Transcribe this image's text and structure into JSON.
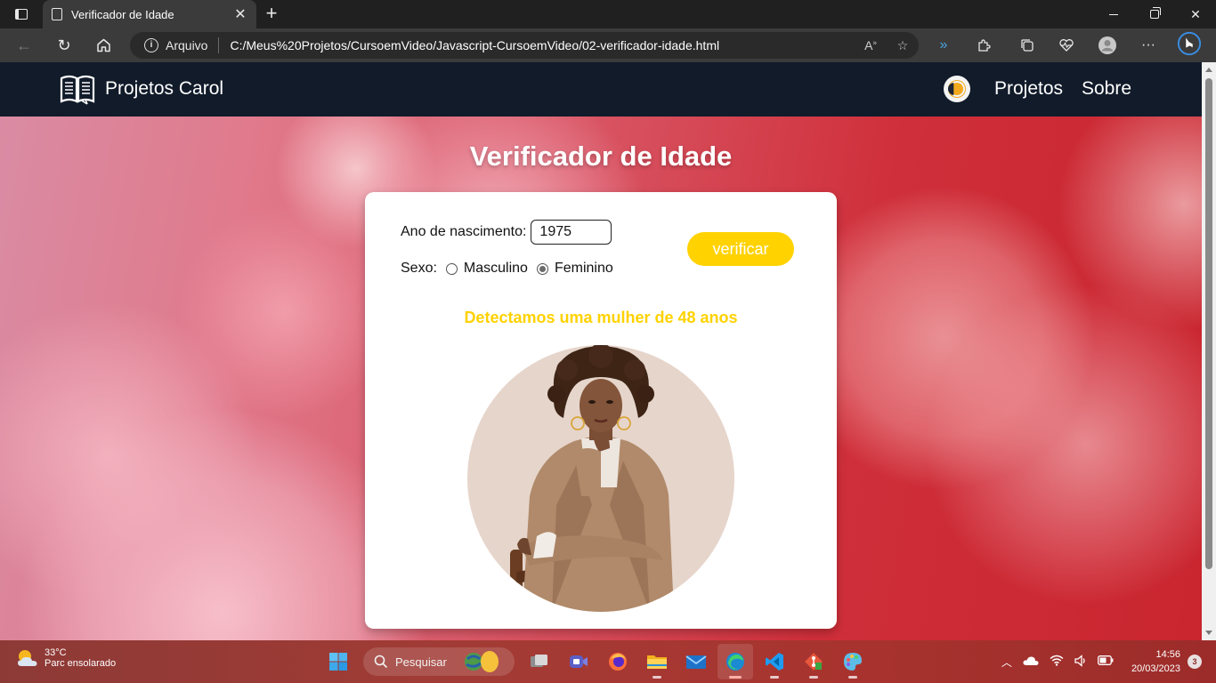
{
  "browser": {
    "tab_title": "Verificador de Idade",
    "site_label": "Arquivo",
    "url": "C:/Meus%20Projetos/CursoemVideo/Javascript-CursoemVideo/02-verificador-idade.html"
  },
  "site": {
    "brand": "Projetos Carol",
    "nav_links": [
      "Projetos",
      "Sobre"
    ]
  },
  "page": {
    "title": "Verificador de Idade",
    "birth_year_label": "Ano de nascimento:",
    "birth_year_value": "1975",
    "sex_label": "Sexo:",
    "sex_options": [
      "Masculino",
      "Feminino"
    ],
    "sex_selected": "Feminino",
    "verify_button": "verificar",
    "result_text": "Detectamos uma mulher de 48 anos",
    "colors": {
      "accent": "#ffd200",
      "nav_bg": "#111b2a"
    }
  },
  "taskbar": {
    "weather_temp": "33°C",
    "weather_desc": "Parc ensolarado",
    "search_placeholder": "Pesquisar",
    "time": "14:56",
    "date": "20/03/2023",
    "notifications": "3"
  }
}
